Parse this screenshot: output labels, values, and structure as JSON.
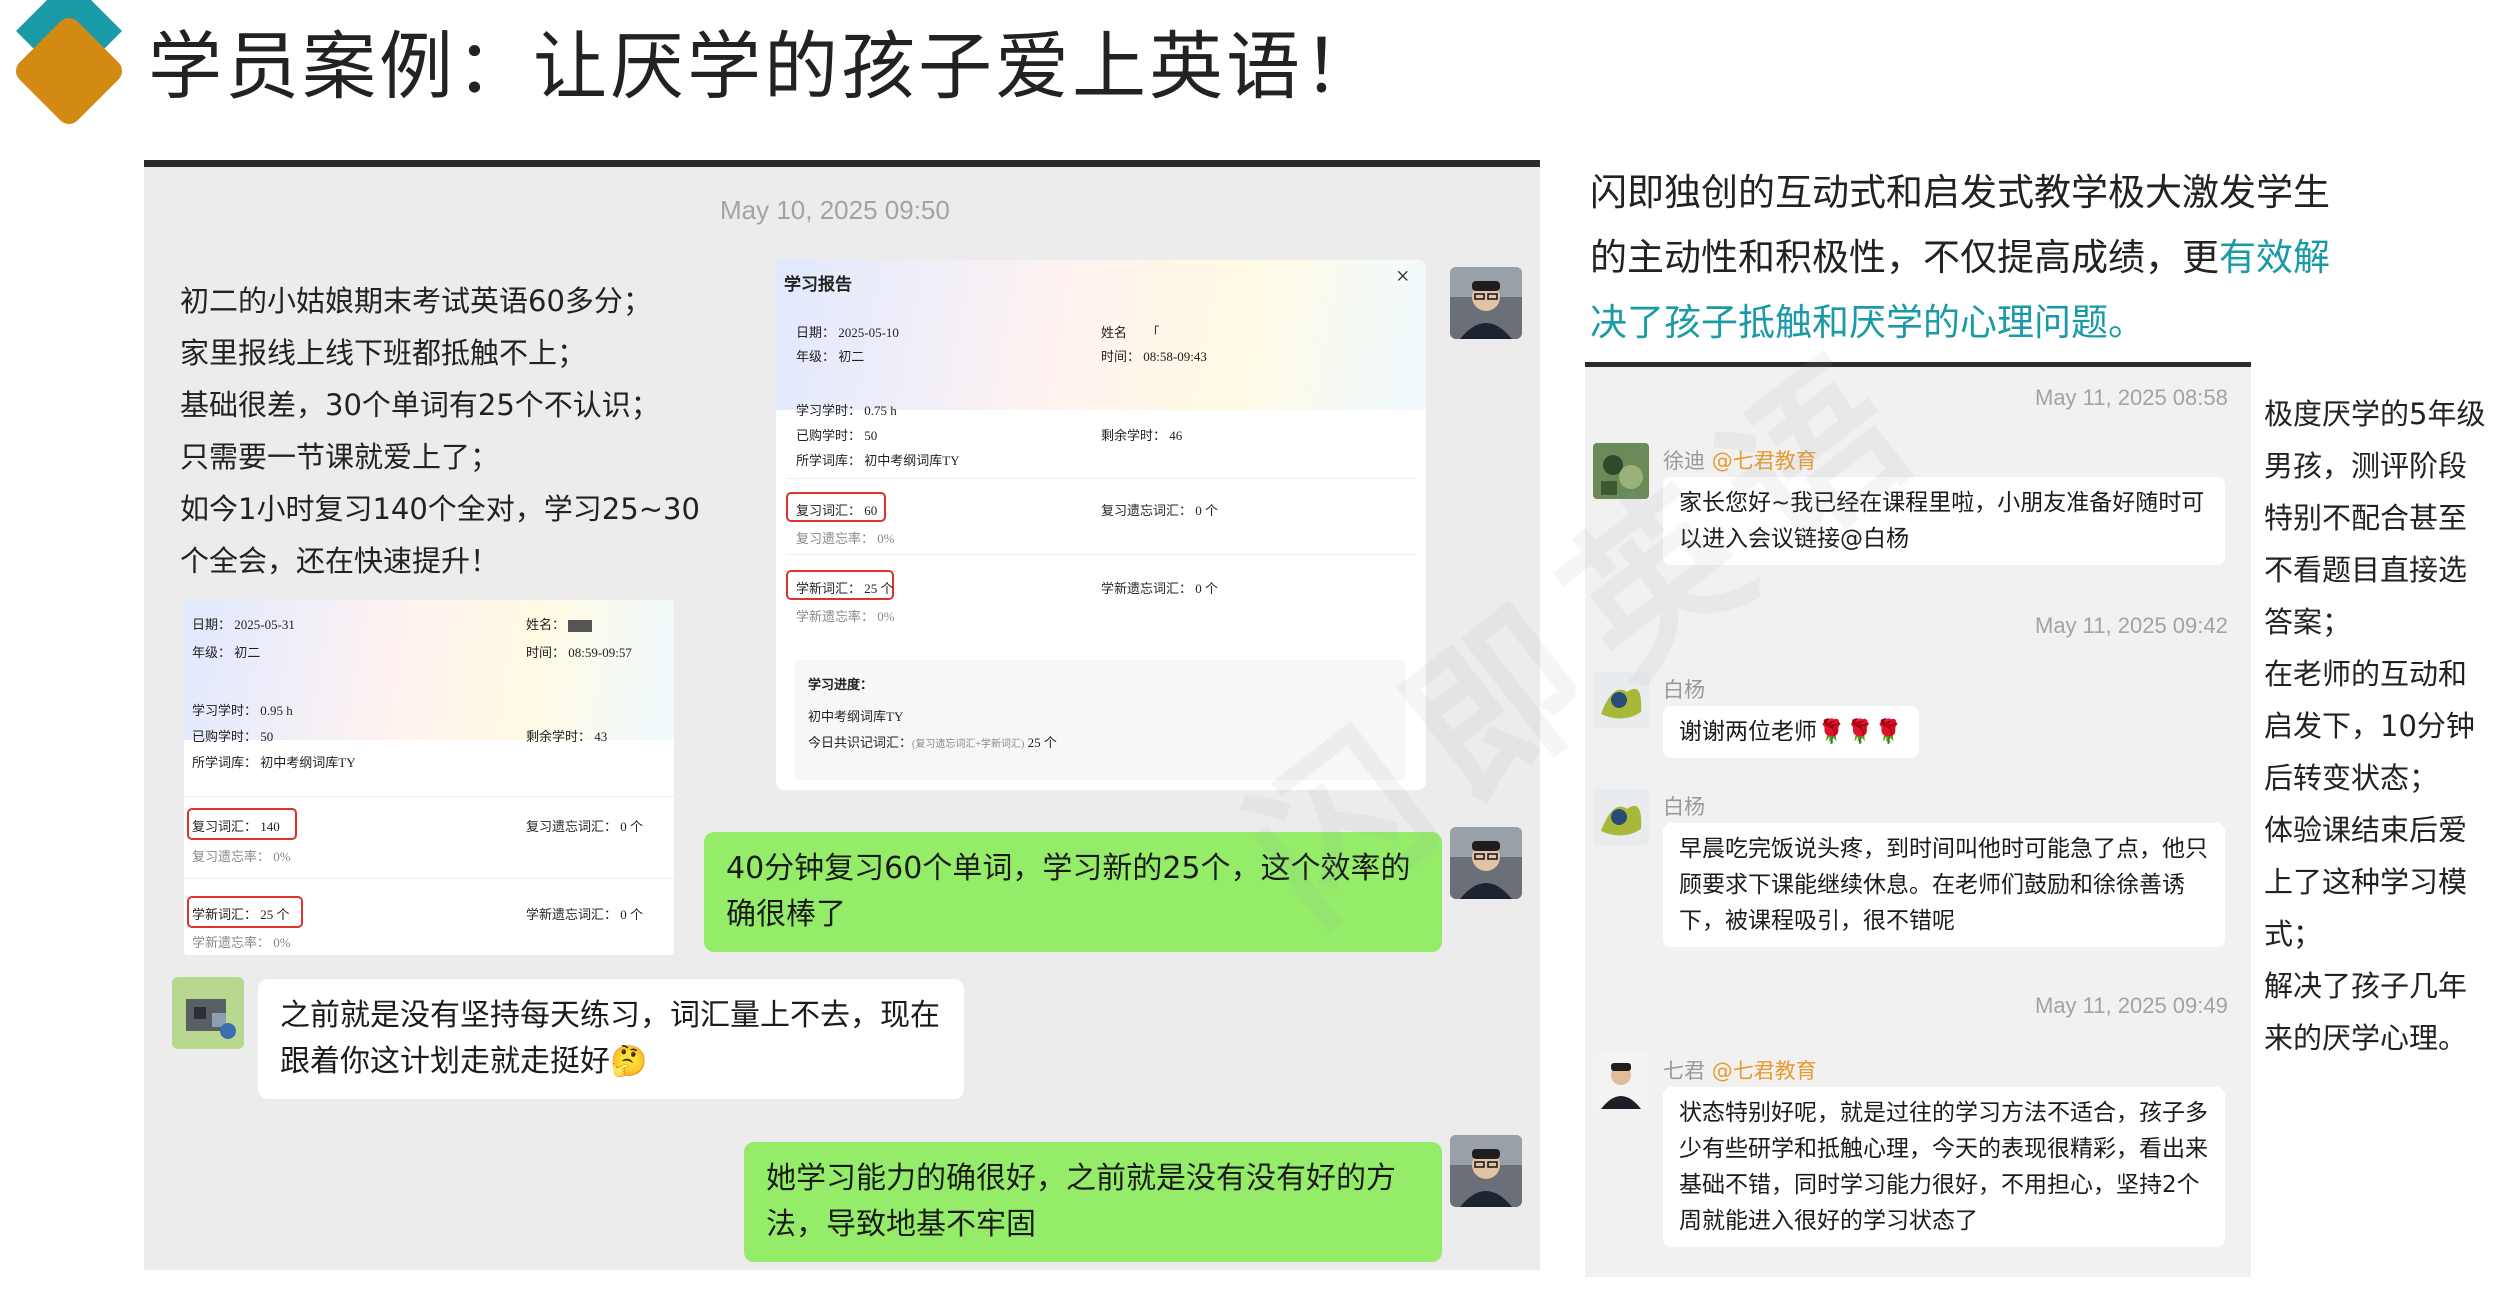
{
  "title": "学员案例：让厌学的孩子爱上英语！",
  "watermark": "闪即英语",
  "left_chat": {
    "timestamp": "May 10, 2025 09:50",
    "intro_lines": [
      "初二的小姑娘期末考试英语60多分；",
      "家里报线上线下班都抵触不上；",
      "基础很差，30个单词有25个不认识；",
      "只需要一节课就爱上了；",
      "如今1小时复习140个全对，学习25~30",
      "个全会，还在快速提升！"
    ],
    "report_big": {
      "title": "学习报告",
      "close": "×",
      "date_label": "日期：",
      "date": "2025-05-10",
      "grade_label": "年级：",
      "grade": "初二",
      "name_label": "姓名",
      "name": "「",
      "time_label": "时间：",
      "time": "08:58-09:43",
      "hours_label": "学习学时：",
      "hours": "0.75 h",
      "bought_label": "已购学时：",
      "bought": "50",
      "remain_label": "剩余学时：",
      "remain": "46",
      "lib_label": "所学词库：",
      "lib": "初中考纲词库TY",
      "review_label": "复习词汇：",
      "review": "60",
      "review_forget_label": "复习遗忘词汇：",
      "review_forget": "0 个",
      "review_rate_label": "复习遗忘率：",
      "review_rate": "0%",
      "new_label": "学新词汇：",
      "new": "25 个",
      "new_forget_label": "学新遗忘词汇：",
      "new_forget": "0 个",
      "new_rate_label": "学新遗忘率：",
      "new_rate": "0%",
      "progress_label": "学习进度：",
      "progress_lib": "初中考纲词库TY",
      "today_label": "今日共识记词汇：",
      "today_sub": "(复习遗忘词汇+学新词汇)",
      "today": "25 个"
    },
    "report_small": {
      "date_label": "日期：",
      "date": "2025-05-31",
      "grade_label": "年级：",
      "grade": "初二",
      "name_label": "姓名：",
      "time_label": "时间：",
      "time": "08:59-09:57",
      "hours_label": "学习学时：",
      "hours": "0.95 h",
      "bought_label": "已购学时：",
      "bought": "50",
      "remain_label": "剩余学时：",
      "remain": "43",
      "lib_label": "所学词库：",
      "lib": "初中考纲词库TY",
      "review_label": "复习词汇：",
      "review": "140",
      "review_forget_label": "复习遗忘词汇：",
      "review_forget": "0 个",
      "review_rate_label": "复习遗忘率：",
      "review_rate": "0%",
      "new_label": "学新词汇：",
      "new": "25 个",
      "new_forget_label": "学新遗忘词汇：",
      "new_forget": "0 个",
      "new_rate_label": "学新遗忘率：",
      "new_rate": "0%"
    },
    "msg1": "40分钟复习60个单词，学习新的25个，这个效率的确很棒了",
    "msg2": "之前就是没有坚持每天练习，词汇量上不去，现在跟着你这计划走就走挺好🤔",
    "msg3": "她学习能力的确很好，之前就是没有没有好的方法，导致地基不牢固"
  },
  "right": {
    "title_line1": "闪即独创的互动式和启发式教学极大激发学生",
    "title_line2a": "的主动性和积极性，不仅提高成绩，更",
    "title_line2b": "有效解",
    "title_line3": "决了孩子抵触和厌学的心理问题。",
    "chat": {
      "ts1": "May 11, 2025 08:58",
      "name1": "徐迪",
      "org1": "@七君教育",
      "msg1": "家长您好~我已经在课程里啦，小朋友准备好随时可以进入会议链接@白杨",
      "ts2": "May 11, 2025 09:42",
      "name2": "白杨",
      "msg2": "谢谢两位老师🌹🌹🌹",
      "name3": "白杨",
      "msg3": "早晨吃完饭说头疼，到时间叫他时可能急了点，他只顾要求下课能继续休息。在老师们鼓励和徐徐善诱下，被课程吸引，很不错呢",
      "ts3": "May 11, 2025 09:49",
      "name4": "七君",
      "org4": "@七君教育",
      "msg4": "状态特别好呢，就是过往的学习方法不适合，孩子多少有些研学和抵触心理，今天的表现很精彩，看出来基础不错，同时学习能力很好，不用担心，坚持2个周就能进入很好的学习状态了"
    },
    "side_lines": [
      "极度厌学的5年级",
      "男孩，测评阶段",
      "特别不配合甚至",
      "不看题目直接选",
      "答案；",
      "在老师的互动和",
      "启发下，10分钟",
      "后转变状态；",
      "体验课结束后爱",
      "上了这种学习模",
      "式；",
      "解决了孩子几年",
      "来的厌学心理。"
    ]
  },
  "colors": {
    "logo_teal": "#1a9aa6",
    "logo_orange": "#d38a12",
    "bubble_green": "#95ec69",
    "highlight": "#e0302b",
    "accent_teal": "#1a9aa6",
    "name_orange": "#e89a2e"
  }
}
